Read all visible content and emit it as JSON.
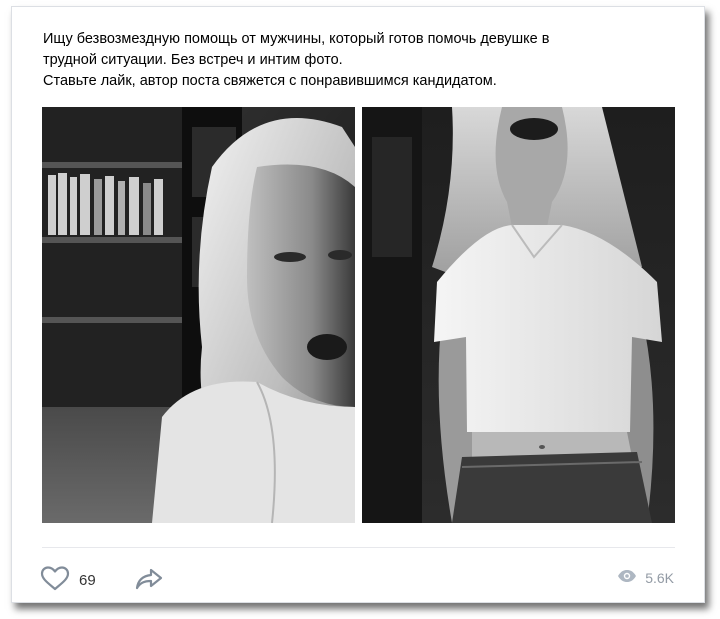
{
  "post": {
    "text_lines": [
      "Ищу безвозмездную помощь от мужчины, который готов помочь девушке в",
      "трудной ситуации. Без встреч и интим фото.",
      "Ставьте лайк, автор поста свяжется с понравившимся кандидатом."
    ]
  },
  "actions": {
    "likes": "69",
    "views": "5.6K"
  },
  "icons": {
    "like": "heart-icon",
    "share": "share-arrow-icon",
    "views": "eye-icon"
  },
  "colors": {
    "text": "#000000",
    "icon_gray": "#818c99",
    "views_text": "#939ba5",
    "divider": "#e7e8ec"
  }
}
